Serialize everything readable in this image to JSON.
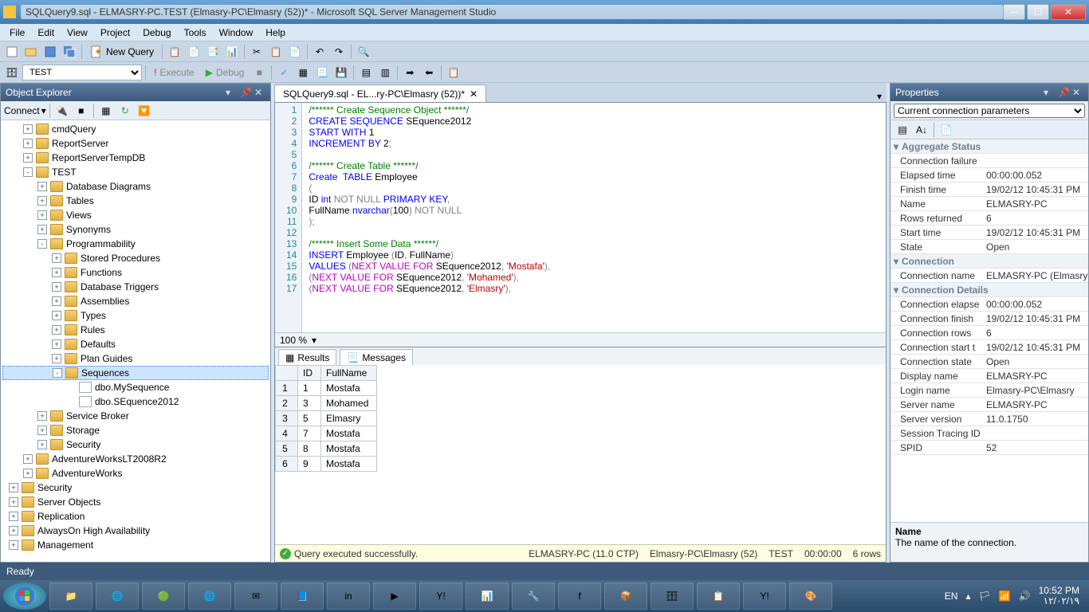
{
  "window": {
    "title": "SQLQuery9.sql - ELMASRY-PC.TEST (Elmasry-PC\\Elmasry (52))* - Microsoft SQL Server Management Studio"
  },
  "menu": [
    "File",
    "Edit",
    "View",
    "Project",
    "Debug",
    "Tools",
    "Window",
    "Help"
  ],
  "toolbar1": {
    "new_query": "New Query"
  },
  "toolbar2": {
    "db_selector": "TEST",
    "execute": "Execute",
    "debug": "Debug"
  },
  "object_explorer": {
    "title": "Object Explorer",
    "connect": "Connect",
    "tree": [
      {
        "d": 1,
        "exp": "+",
        "icon": "folder",
        "label": "cmdQuery"
      },
      {
        "d": 1,
        "exp": "+",
        "icon": "folder",
        "label": "ReportServer"
      },
      {
        "d": 1,
        "exp": "+",
        "icon": "folder",
        "label": "ReportServerTempDB"
      },
      {
        "d": 1,
        "exp": "-",
        "icon": "folder",
        "label": "TEST"
      },
      {
        "d": 2,
        "exp": "+",
        "icon": "folder",
        "label": "Database Diagrams"
      },
      {
        "d": 2,
        "exp": "+",
        "icon": "folder",
        "label": "Tables"
      },
      {
        "d": 2,
        "exp": "+",
        "icon": "folder",
        "label": "Views"
      },
      {
        "d": 2,
        "exp": "+",
        "icon": "folder",
        "label": "Synonyms"
      },
      {
        "d": 2,
        "exp": "-",
        "icon": "folder",
        "label": "Programmability"
      },
      {
        "d": 3,
        "exp": "+",
        "icon": "folder",
        "label": "Stored Procedures"
      },
      {
        "d": 3,
        "exp": "+",
        "icon": "folder",
        "label": "Functions"
      },
      {
        "d": 3,
        "exp": "+",
        "icon": "folder",
        "label": "Database Triggers"
      },
      {
        "d": 3,
        "exp": "+",
        "icon": "folder",
        "label": "Assemblies"
      },
      {
        "d": 3,
        "exp": "+",
        "icon": "folder",
        "label": "Types"
      },
      {
        "d": 3,
        "exp": "+",
        "icon": "folder",
        "label": "Rules"
      },
      {
        "d": 3,
        "exp": "+",
        "icon": "folder",
        "label": "Defaults"
      },
      {
        "d": 3,
        "exp": "+",
        "icon": "folder",
        "label": "Plan Guides"
      },
      {
        "d": 3,
        "exp": "-",
        "icon": "folder",
        "label": "Sequences",
        "selected": true
      },
      {
        "d": 4,
        "exp": "",
        "icon": "file",
        "label": "dbo.MySequence"
      },
      {
        "d": 4,
        "exp": "",
        "icon": "file",
        "label": "dbo.SEquence2012"
      },
      {
        "d": 2,
        "exp": "+",
        "icon": "folder",
        "label": "Service Broker"
      },
      {
        "d": 2,
        "exp": "+",
        "icon": "folder",
        "label": "Storage"
      },
      {
        "d": 2,
        "exp": "+",
        "icon": "folder",
        "label": "Security"
      },
      {
        "d": 1,
        "exp": "+",
        "icon": "folder",
        "label": "AdventureWorksLT2008R2"
      },
      {
        "d": 1,
        "exp": "+",
        "icon": "folder",
        "label": "AdventureWorks"
      },
      {
        "d": 0,
        "exp": "+",
        "icon": "folder",
        "label": "Security"
      },
      {
        "d": 0,
        "exp": "+",
        "icon": "folder",
        "label": "Server Objects"
      },
      {
        "d": 0,
        "exp": "+",
        "icon": "folder",
        "label": "Replication"
      },
      {
        "d": 0,
        "exp": "+",
        "icon": "folder",
        "label": "AlwaysOn High Availability"
      },
      {
        "d": 0,
        "exp": "+",
        "icon": "folder",
        "label": "Management"
      }
    ]
  },
  "editor_tab": "SQLQuery9.sql - EL...ry-PC\\Elmasry (52))*",
  "code_lines": [
    {
      "n": 1,
      "html": "<span class='cm'>/****** Create Sequence Object ******/</span>"
    },
    {
      "n": 2,
      "html": "<span class='kw'>CREATE</span> <span class='kw'>SEQUENCE</span> SEquence2012"
    },
    {
      "n": 3,
      "html": "<span class='kw'>START</span> <span class='kw'>WITH</span> 1"
    },
    {
      "n": 4,
      "html": "<span class='kw'>INCREMENT</span> <span class='kw'>BY</span> 2<span class='gray'>;</span>"
    },
    {
      "n": 5,
      "html": ""
    },
    {
      "n": 6,
      "html": "<span class='cm'>/****** Create Table ******/</span>"
    },
    {
      "n": 7,
      "html": "<span class='kw'>Create</span>  <span class='kw'>TABLE</span> Employee"
    },
    {
      "n": 8,
      "html": "<span class='gray'>(</span>"
    },
    {
      "n": 9,
      "html": "ID <span class='kw'>int</span> <span class='gray'>NOT NULL</span> <span class='kw'>PRIMARY</span> <span class='kw'>KEY</span><span class='gray'>,</span>"
    },
    {
      "n": 10,
      "html": "FullName <span class='kw'>nvarchar</span><span class='gray'>(</span>100<span class='gray'>)</span> <span class='gray'>NOT NULL</span>"
    },
    {
      "n": 11,
      "html": "<span class='gray'>);</span>"
    },
    {
      "n": 12,
      "html": ""
    },
    {
      "n": 13,
      "html": "<span class='cm'>/****** Insert Some Data ******/</span>"
    },
    {
      "n": 14,
      "html": "<span class='kw'>INSERT</span> Employee <span class='gray'>(</span>ID<span class='gray'>,</span> FullName<span class='gray'>)</span>"
    },
    {
      "n": 15,
      "html": "<span class='kw'>VALUES</span> <span class='gray'>(</span><span class='fn'>NEXT VALUE FOR</span> SEquence2012<span class='gray'>,</span> <span class='str'>'Mostafa'</span><span class='gray'>),</span>"
    },
    {
      "n": 16,
      "html": "<span class='gray'>(</span><span class='fn'>NEXT VALUE FOR</span> SEquence2012<span class='gray'>,</span> <span class='str'>'Mohamed'</span><span class='gray'>),</span>"
    },
    {
      "n": 17,
      "html": "<span class='gray'>(</span><span class='fn'>NEXT VALUE FOR</span> SEquence2012<span class='gray'>,</span> <span class='str'>'Elmasry'</span><span class='gray'>),</span>"
    }
  ],
  "zoom": "100 %",
  "results": {
    "tab_results": "Results",
    "tab_messages": "Messages",
    "columns": [
      "ID",
      "FullName"
    ],
    "rows": [
      [
        "1",
        "Mostafa"
      ],
      [
        "3",
        "Mohamed"
      ],
      [
        "5",
        "Elmasry"
      ],
      [
        "7",
        "Mostafa"
      ],
      [
        "8",
        "Mostafa"
      ],
      [
        "9",
        "Mostafa"
      ]
    ]
  },
  "statusline": {
    "msg": "Query executed successfully.",
    "server": "ELMASRY-PC (11.0 CTP)",
    "user": "Elmasry-PC\\Elmasry (52)",
    "db": "TEST",
    "time": "00:00:00",
    "rows": "6 rows"
  },
  "properties": {
    "title": "Properties",
    "subject": "Current connection parameters",
    "groups": [
      {
        "cat": "Aggregate Status",
        "rows": [
          {
            "k": "Connection failure",
            "v": ""
          },
          {
            "k": "Elapsed time",
            "v": "00:00:00.052"
          },
          {
            "k": "Finish time",
            "v": "19/02/12 10:45:31 PM"
          },
          {
            "k": "Name",
            "v": "ELMASRY-PC"
          },
          {
            "k": "Rows returned",
            "v": "6"
          },
          {
            "k": "Start time",
            "v": "19/02/12 10:45:31 PM"
          },
          {
            "k": "State",
            "v": "Open"
          }
        ]
      },
      {
        "cat": "Connection",
        "rows": [
          {
            "k": "Connection name",
            "v": "ELMASRY-PC (Elmasry-"
          }
        ]
      },
      {
        "cat": "Connection Details",
        "rows": [
          {
            "k": "Connection elapse",
            "v": "00:00:00.052"
          },
          {
            "k": "Connection finish",
            "v": "19/02/12 10:45:31 PM"
          },
          {
            "k": "Connection rows",
            "v": "6"
          },
          {
            "k": "Connection start t",
            "v": "19/02/12 10:45:31 PM"
          },
          {
            "k": "Connection state",
            "v": "Open"
          },
          {
            "k": "Display name",
            "v": "ELMASRY-PC"
          },
          {
            "k": "Login name",
            "v": "Elmasry-PC\\Elmasry"
          },
          {
            "k": "Server name",
            "v": "ELMASRY-PC"
          },
          {
            "k": "Server version",
            "v": "11.0.1750"
          },
          {
            "k": "Session Tracing ID",
            "v": ""
          },
          {
            "k": "SPID",
            "v": "52"
          }
        ]
      }
    ],
    "desc_name": "Name",
    "desc_text": "The name of the connection."
  },
  "appstatus": "Ready",
  "taskbar": {
    "lang": "EN",
    "time": "10:52 PM",
    "date": "١٢/٠٢/١٩"
  }
}
